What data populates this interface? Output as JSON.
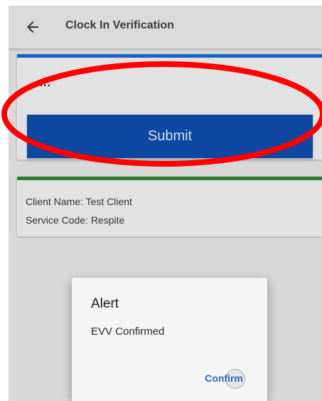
{
  "app_bar": {
    "back_icon": "arrow-left-icon",
    "title": "Clock In Verification"
  },
  "entry_card": {
    "accent_color": "#1565c0",
    "code_value": "....",
    "submit_label": "Submit",
    "submit_color": "#0d47a1"
  },
  "info_card": {
    "accent_color": "#2e7d32",
    "client_name": "Client Name: Test Client",
    "service_code": "Service Code: Respite"
  },
  "annotation": {
    "shape": "ellipse",
    "color": "#ff0000"
  },
  "dialog": {
    "title": "Alert",
    "message": "EVV Confirmed",
    "confirm_label": "Confirm"
  }
}
